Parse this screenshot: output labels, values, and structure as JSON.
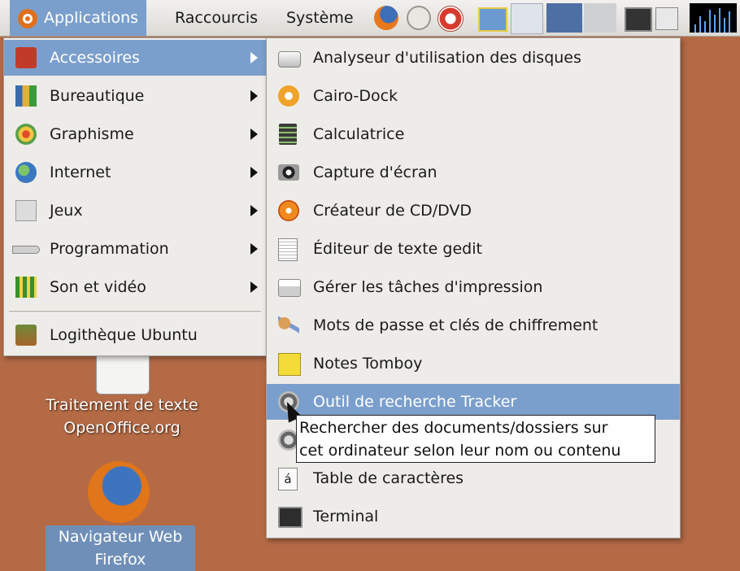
{
  "panel": {
    "menus": [
      "Applications",
      "Raccourcis",
      "Système"
    ],
    "launchers": [
      "firefox-icon",
      "mail-icon",
      "help-icon",
      "screen-icon",
      "terminal-icon"
    ]
  },
  "applications_menu": {
    "items": [
      {
        "label": "Accessoires",
        "icon": "accessories-icon",
        "submenu": true
      },
      {
        "label": "Bureautique",
        "icon": "office-icon",
        "submenu": true
      },
      {
        "label": "Graphisme",
        "icon": "graphics-icon",
        "submenu": true
      },
      {
        "label": "Internet",
        "icon": "internet-globe-icon",
        "submenu": true
      },
      {
        "label": "Jeux",
        "icon": "games-icon",
        "submenu": true
      },
      {
        "label": "Programmation",
        "icon": "programming-icon",
        "submenu": true
      },
      {
        "label": "Son et vidéo",
        "icon": "sound-video-icon",
        "submenu": true
      }
    ],
    "footer_item": {
      "label": "Logithèque Ubuntu",
      "icon": "software-center-icon"
    }
  },
  "accessories_menu": {
    "items": [
      {
        "label": "Analyseur d'utilisation des disques",
        "icon": "disk-usage-icon"
      },
      {
        "label": "Cairo-Dock",
        "icon": "cairo-dock-icon"
      },
      {
        "label": "Calculatrice",
        "icon": "calculator-icon"
      },
      {
        "label": "Capture d'écran",
        "icon": "camera-icon"
      },
      {
        "label": "Créateur de CD/DVD",
        "icon": "cd-burner-icon"
      },
      {
        "label": "Éditeur de texte gedit",
        "icon": "text-editor-icon"
      },
      {
        "label": "Gérer les tâches d'impression",
        "icon": "printer-icon"
      },
      {
        "label": "Mots de passe et clés de chiffrement",
        "icon": "keys-icon"
      },
      {
        "label": "Notes Tomboy",
        "icon": "notes-icon"
      },
      {
        "label": "Outil de recherche Tracker",
        "icon": "tracker-search-icon"
      },
      {
        "label": "",
        "icon": "tracker-search-icon"
      },
      {
        "label": "Table de caractères",
        "icon": "character-map-icon"
      },
      {
        "label": "Terminal",
        "icon": "terminal-icon"
      }
    ],
    "highlighted": "Outil de recherche Tracker"
  },
  "tooltip": {
    "line1": "Rechercher des documents/dossiers sur",
    "line2": "cet ordinateur selon leur nom ou contenu"
  },
  "desktop": {
    "doc_icon": {
      "line1": "Traitement de texte",
      "line2": "OpenOffice.org"
    },
    "firefox_icon": {
      "line1": "Navigateur Web",
      "line2": "Firefox"
    }
  },
  "colors": {
    "desktop": "#b46a45",
    "highlight": "#7b9fcc",
    "menu_bg": "#eeece9"
  }
}
